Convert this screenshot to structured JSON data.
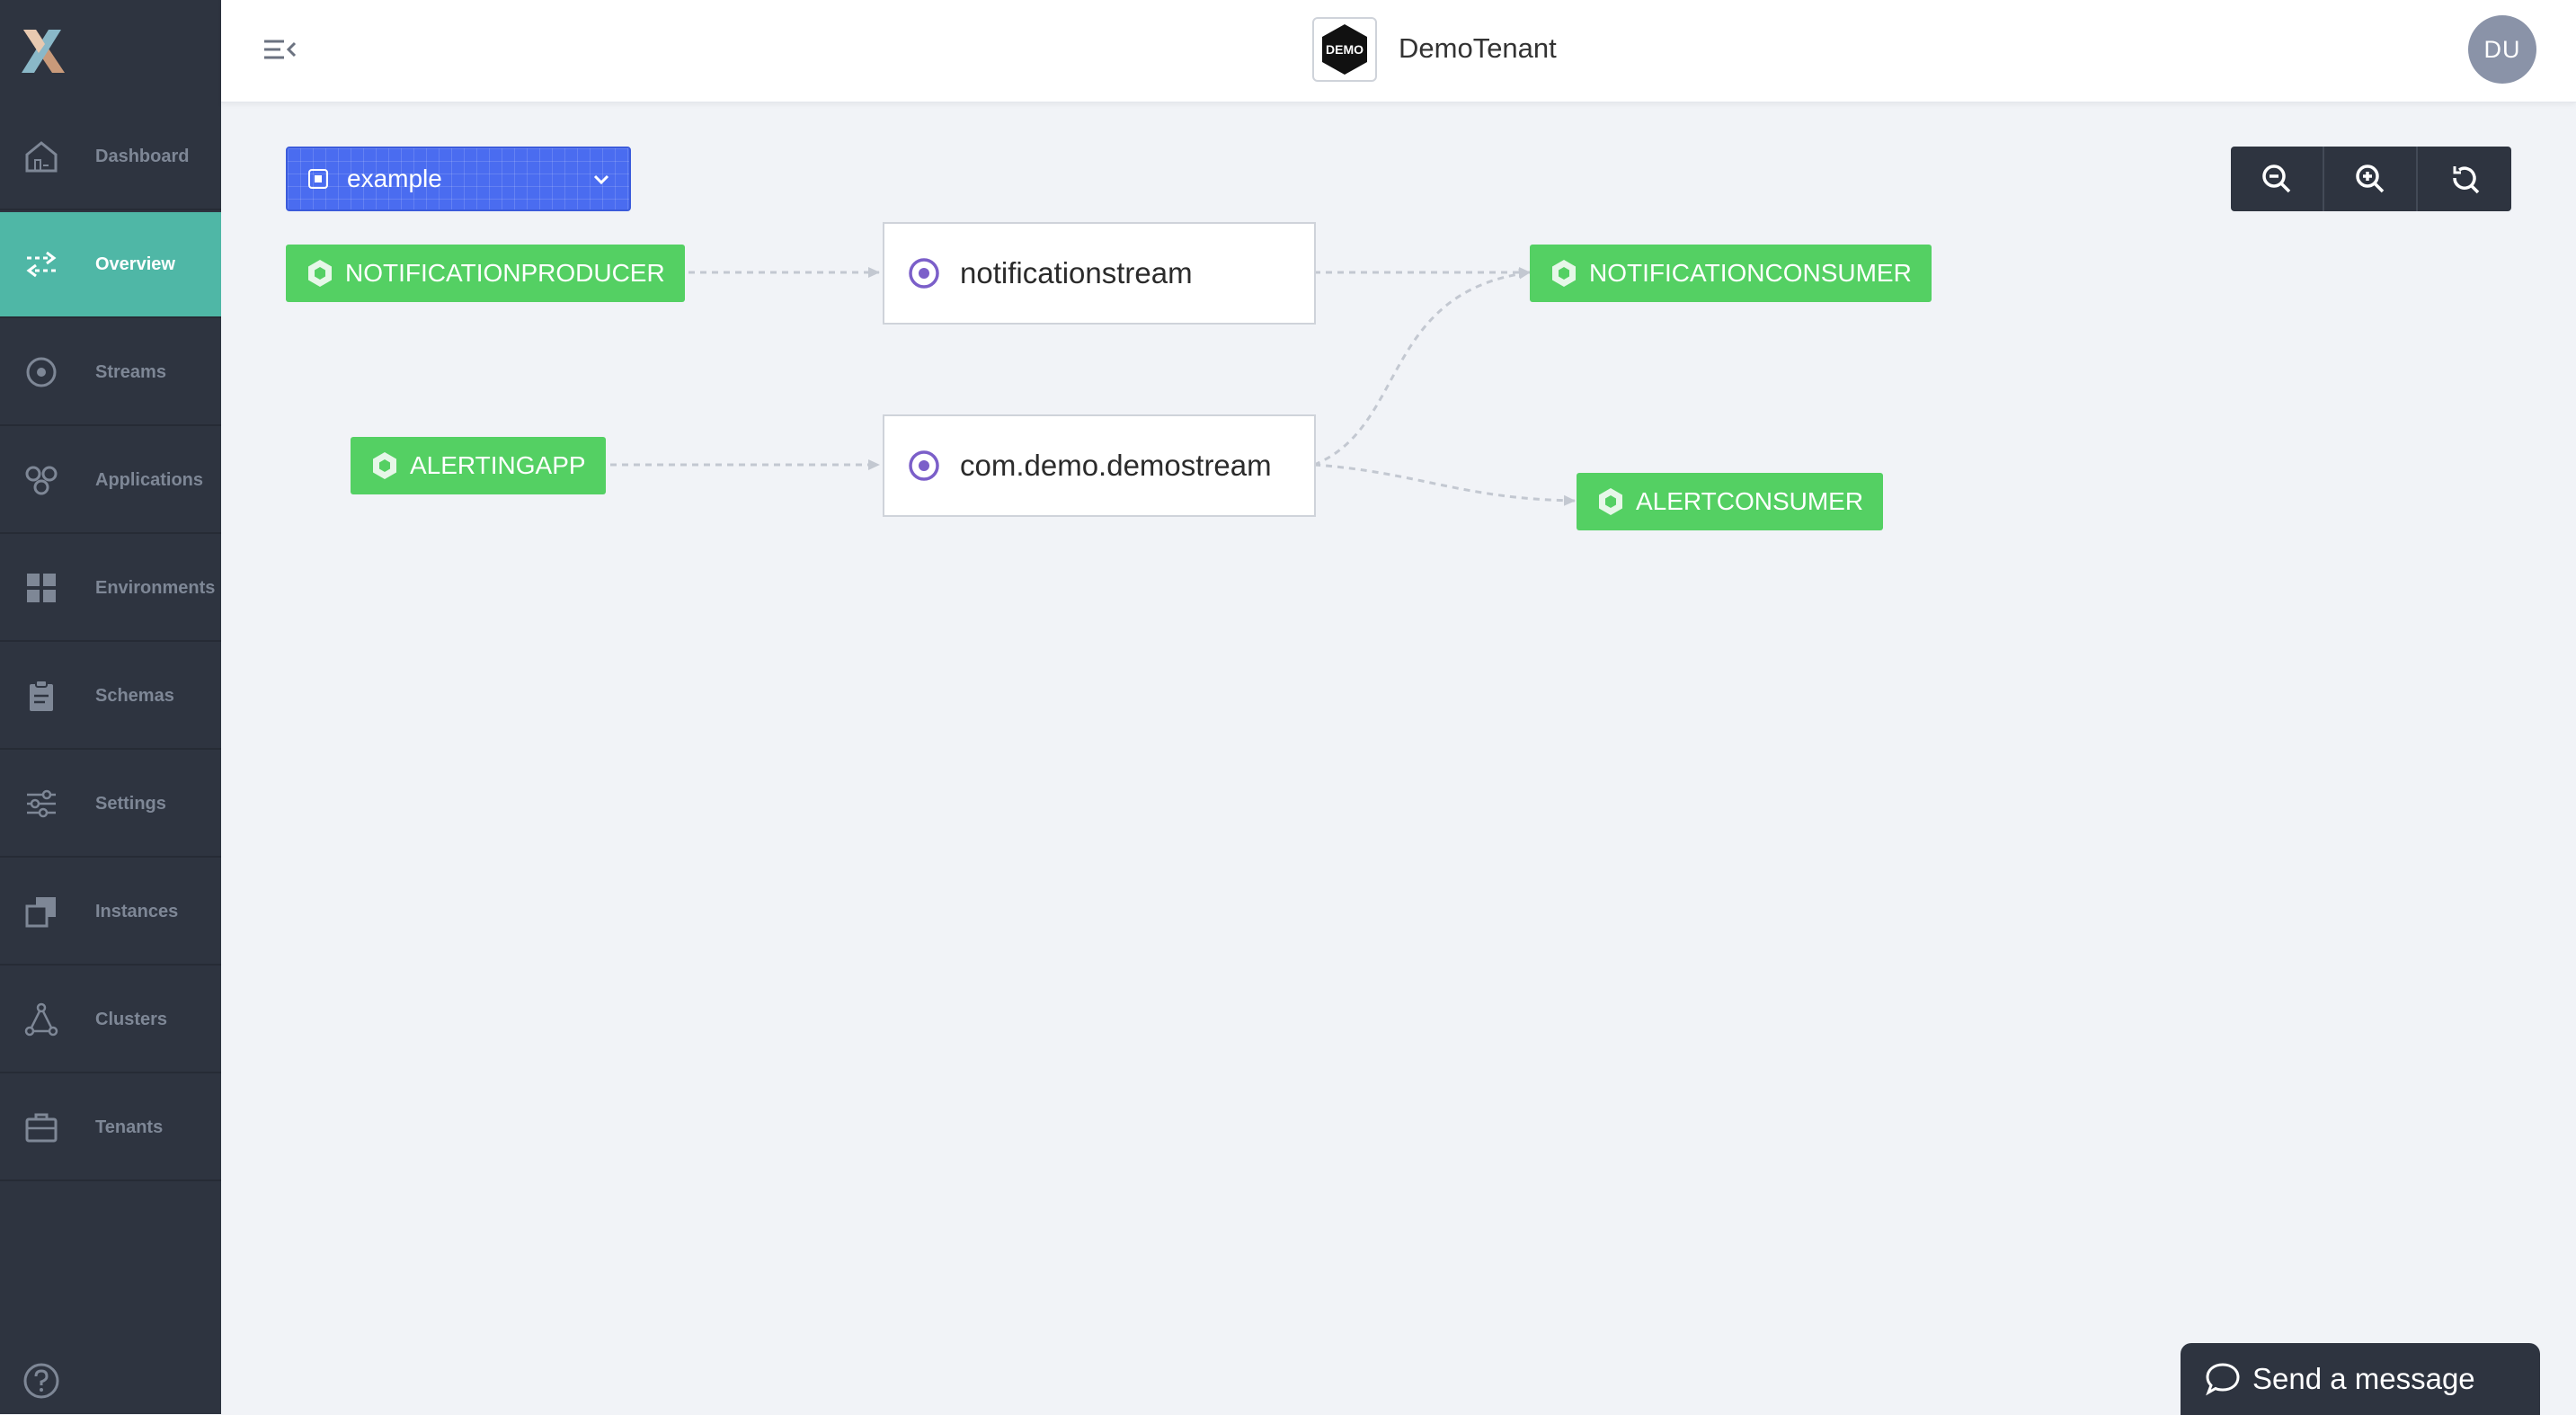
{
  "sidebar": {
    "items": [
      {
        "label": "Dashboard",
        "icon": "home-icon"
      },
      {
        "label": "Overview",
        "icon": "arrows-exchange-icon",
        "active": true
      },
      {
        "label": "Streams",
        "icon": "stream-circle-icon"
      },
      {
        "label": "Applications",
        "icon": "applications-icon"
      },
      {
        "label": "Environments",
        "icon": "grid-icon"
      },
      {
        "label": "Schemas",
        "icon": "clipboard-icon"
      },
      {
        "label": "Settings",
        "icon": "sliders-icon"
      },
      {
        "label": "Instances",
        "icon": "instances-icon"
      },
      {
        "label": "Clusters",
        "icon": "cluster-icon"
      },
      {
        "label": "Tenants",
        "icon": "briefcase-icon"
      }
    ],
    "help_icon": "help-icon"
  },
  "header": {
    "tenant_logo_text": "DEMO",
    "tenant_name": "DemoTenant",
    "avatar_initials": "DU"
  },
  "environment_select": {
    "value": "example"
  },
  "graph": {
    "applications": [
      {
        "label": "NOTIFICATIONPRODUCER"
      },
      {
        "label": "NOTIFICATIONCONSUMER"
      },
      {
        "label": "ALERTINGAPP"
      },
      {
        "label": "ALERTCONSUMER"
      }
    ],
    "streams": [
      {
        "label": "notificationstream"
      },
      {
        "label": "com.demo.demostream"
      }
    ]
  },
  "chat": {
    "label": "Send a message"
  },
  "colors": {
    "sidebar_bg": "#2e3440",
    "active_item": "#4fb7a6",
    "app_node": "#54d063",
    "stream_icon": "#7b5fc9",
    "select_bg": "#4a6cf0"
  }
}
